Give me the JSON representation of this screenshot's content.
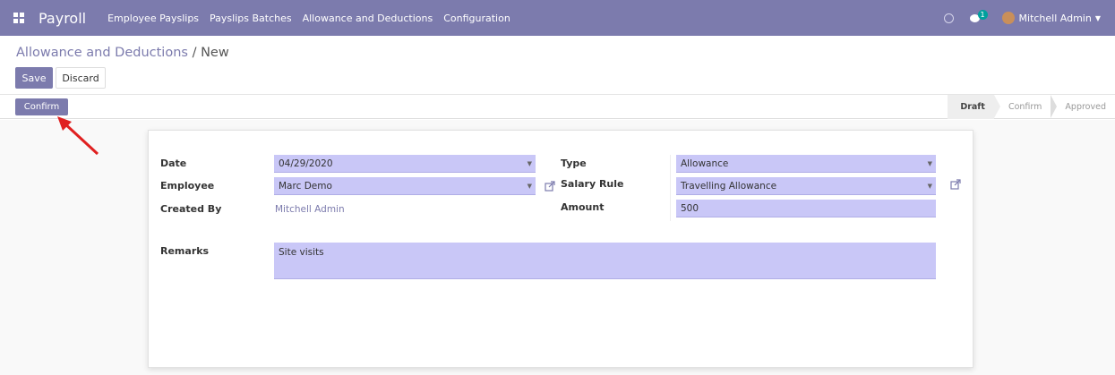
{
  "navbar": {
    "brand": "Payroll",
    "menu": [
      "Employee Payslips",
      "Payslips Batches",
      "Allowance and Deductions",
      "Configuration"
    ],
    "chat_count": "1",
    "user_name": "Mitchell Admin"
  },
  "breadcrumb": {
    "parent": "Allowance and Deductions",
    "separator": " / ",
    "current": "New"
  },
  "buttons": {
    "save": "Save",
    "discard": "Discard",
    "confirm": "Confirm"
  },
  "stages": [
    "Draft",
    "Confirm",
    "Approved"
  ],
  "active_stage": "Draft",
  "form": {
    "date_label": "Date",
    "date_value": "04/29/2020",
    "employee_label": "Employee",
    "employee_value": "Marc Demo",
    "created_by_label": "Created By",
    "created_by_value": "Mitchell Admin",
    "type_label": "Type",
    "type_value": "Allowance",
    "salary_rule_label": "Salary Rule",
    "salary_rule_value": "Travelling Allowance",
    "amount_label": "Amount",
    "amount_value": "500",
    "remarks_label": "Remarks",
    "remarks_value": "Site visits"
  },
  "colors": {
    "brand": "#7c7bad",
    "field_bg": "#c9c7f7",
    "annotation_arrow": "#e02020"
  }
}
